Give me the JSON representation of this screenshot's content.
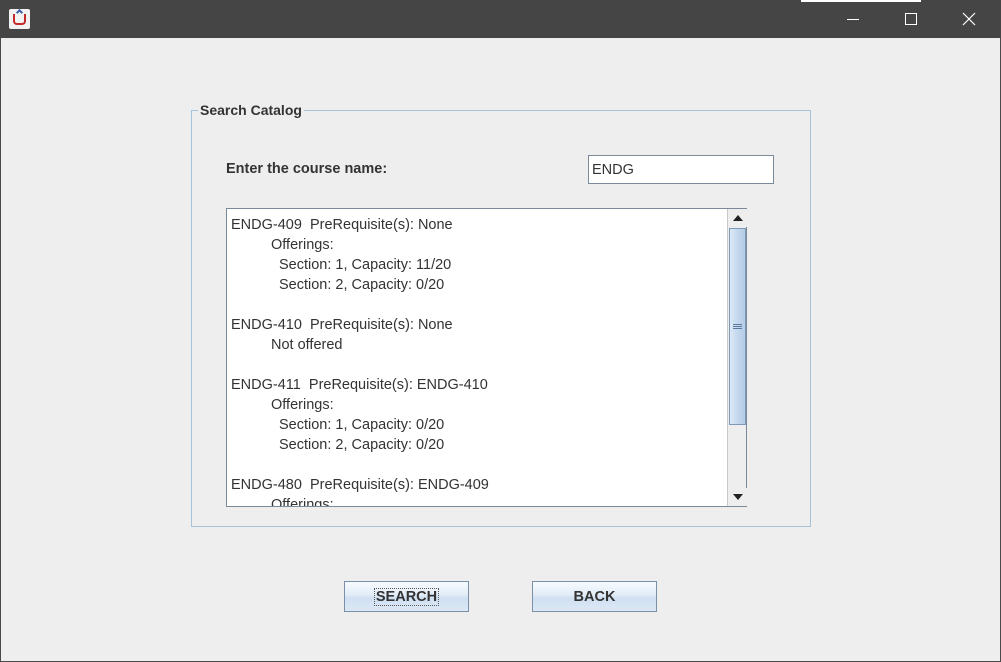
{
  "window": {
    "title": "",
    "icon": "java-cup-icon"
  },
  "catalog": {
    "group_title": "Search Catalog",
    "course_label": "Enter the course name:",
    "course_value": "ENDG",
    "results": [
      {
        "header": "ENDG-409  PreRequisite(s): None",
        "status": "Offerings:",
        "sections": [
          "Section: 1, Capacity: 11/20",
          "Section: 2, Capacity: 0/20"
        ]
      },
      {
        "header": "ENDG-410  PreRequisite(s): None",
        "status": "Not offered",
        "sections": []
      },
      {
        "header": "ENDG-411  PreRequisite(s): ENDG-410",
        "status": "Offerings:",
        "sections": [
          "Section: 1, Capacity: 0/20",
          "Section: 2, Capacity: 0/20"
        ]
      },
      {
        "header": "ENDG-480  PreRequisite(s): ENDG-409",
        "status": "Offerings:",
        "sections": []
      }
    ]
  },
  "buttons": {
    "search_label": "SEARCH",
    "back_label": "BACK"
  },
  "colors": {
    "titlebar": "#454545",
    "window_bg": "#eeeeee",
    "group_border": "#a6c3dc",
    "text": "#333333"
  }
}
